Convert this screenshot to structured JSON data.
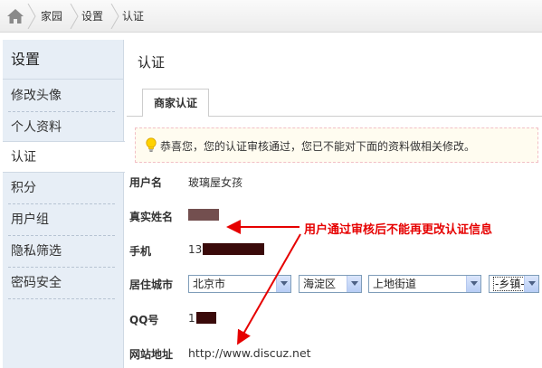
{
  "breadcrumb": {
    "items": [
      "家园",
      "设置",
      "认证"
    ]
  },
  "sidebar": {
    "title": "设置",
    "items": [
      {
        "label": "修改头像"
      },
      {
        "label": "个人资料"
      },
      {
        "label": "认证"
      },
      {
        "label": "积分"
      },
      {
        "label": "用户组"
      },
      {
        "label": "隐私筛选"
      },
      {
        "label": "密码安全"
      }
    ],
    "active_index": 2
  },
  "main": {
    "title": "认证",
    "tab": "商家认证",
    "notice": "恭喜您，您的认证审核通过，您已不能对下面的资料做相关修改。"
  },
  "form": {
    "username": {
      "label": "用户名",
      "value": "玻璃屋女孩"
    },
    "realname": {
      "label": "真实姓名"
    },
    "phone": {
      "label": "手机",
      "value_prefix": "13"
    },
    "city": {
      "label": "居住城市",
      "province": "北京市",
      "district": "海淀区",
      "street": "上地街道",
      "town": "-乡镇-"
    },
    "qq": {
      "label": "QQ号",
      "value_prefix": "1"
    },
    "website": {
      "label": "网站地址",
      "value": "http://www.discuz.net"
    }
  },
  "annotation": {
    "text": "用户通过审核后不能再更改认证信息",
    "color": "#e60000"
  },
  "colors": {
    "sidebar_bg": "#e7eef6",
    "notice_bg": "#fffcf0",
    "notice_border": "#f2bfc6",
    "redaction": "#3a0a0a"
  }
}
